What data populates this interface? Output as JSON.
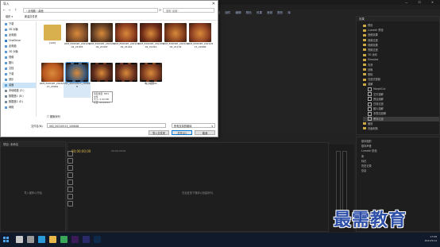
{
  "app": {
    "title": "Adobe Premiere Pro 2020 - C:\\用户\\Admin\\文档\\Adobe\\Premiere Pro\\14.0\\未命名 *",
    "window_controls": "— ☐ ✕",
    "menu": [
      "文件(F)",
      "编辑(E)",
      "剪辑(C)",
      "序列(S)",
      "标记(M)",
      "图形(G)",
      "视图(V)",
      "窗口(W)",
      "帮助(H)"
    ],
    "workspace_tabs": [
      "学习",
      "组件",
      "编辑",
      "颜色",
      "效果",
      "音频",
      "图形",
      "库"
    ]
  },
  "dialog": {
    "title": "导入",
    "close": "✕",
    "nav": {
      "back": "←",
      "forward": "→",
      "up": "↑",
      "refresh": "⟳"
    },
    "address": "› 此电脑 › 桌面",
    "search_placeholder": "搜索\"桌面\"",
    "toolbar": {
      "organize": "组织 ▾",
      "new_folder": "新建文件夹"
    },
    "sidebar": [
      {
        "label": "下载",
        "icon": "download-icon"
      },
      {
        "label": "3D 对象",
        "icon": "cube-icon"
      },
      {
        "label": "此电脑",
        "icon": "computer-icon"
      },
      {
        "label": "OneDrive",
        "icon": "cloud-icon"
      },
      {
        "label": "此电脑",
        "icon": "computer-icon"
      },
      {
        "label": "3D 对象",
        "icon": "cube-icon"
      },
      {
        "label": "视频",
        "icon": "video-icon"
      },
      {
        "label": "图片",
        "icon": "picture-icon"
      },
      {
        "label": "文档",
        "icon": "document-icon"
      },
      {
        "label": "下载",
        "icon": "download-icon"
      },
      {
        "label": "音乐",
        "icon": "music-icon"
      },
      {
        "label": "桌面",
        "icon": "desktop-icon",
        "selected": true
      },
      {
        "label": "本地磁盘 (C:)",
        "icon": "drive-icon"
      },
      {
        "label": "数据盘1 (D:)",
        "icon": "drive-icon"
      },
      {
        "label": "数据盘2 (E:)",
        "icon": "drive-icon"
      },
      {
        "label": "网络",
        "icon": "network-icon"
      }
    ],
    "files": [
      {
        "label": "[120]",
        "kind": "folder",
        "color": "#d8b14e"
      },
      {
        "label": "LRM_EXPORT_20210502_21003",
        "kind": "image",
        "color": "#7a4a2a"
      },
      {
        "label": "LRM_EXPORT_20210502_21003",
        "kind": "image",
        "color": "#5c3a24"
      },
      {
        "label": "LRM_EXPORT_20210502_21012",
        "kind": "image",
        "color": "#8a3a1e"
      },
      {
        "label": "LRM_EXPORT_20210502_21012",
        "kind": "image",
        "color": "#6b2a18"
      },
      {
        "label": "LRM_EXPORT_20210502_21132",
        "kind": "image",
        "color": "#7f3b1c"
      },
      {
        "label": "LRM_EXPORT_20210513_20006",
        "kind": "image",
        "color": "#8c3e22"
      },
      {
        "label": "LRM_EXPORT_20210513_20061",
        "kind": "image",
        "color": "#b8551f"
      },
      {
        "label": "VID_20210513_100648",
        "kind": "video",
        "color": "#3e5a7a",
        "selected": true
      },
      {
        "label": "",
        "kind": "video",
        "color": "#5a2a1c"
      },
      {
        "label": "",
        "kind": "video",
        "color": "#6a3020"
      },
      {
        "label": "电子相册01",
        "kind": "video",
        "color": "#7a3a20"
      }
    ],
    "tooltip": [
      "项目类型: MP4 文件",
      "大小: 4.00 MB",
      "长度: 00:00:01"
    ],
    "sequence_label": "图像序列",
    "filename_label": "文件名(N):",
    "filename_value": "VID_20210513_100648",
    "filetype_value": "所有支持的媒体",
    "buttons": {
      "import_folder": "导入文件夹",
      "open": "打开(O)",
      "cancel": "取消"
    }
  },
  "effects_panel": {
    "title": "效果",
    "items": [
      {
        "label": "预设",
        "type": "folder"
      },
      {
        "label": "Lumetri 预设",
        "type": "folder"
      },
      {
        "label": "音频效果",
        "type": "folder"
      },
      {
        "label": "音频过渡",
        "type": "folder"
      },
      {
        "label": "视频效果",
        "type": "folder"
      },
      {
        "label": "视频过渡",
        "type": "folder"
      },
      {
        "label": "3D 运动",
        "type": "folder"
      },
      {
        "label": "Dissolve",
        "type": "folder"
      },
      {
        "label": "内滑",
        "type": "folder"
      },
      {
        "label": "划像",
        "type": "folder"
      },
      {
        "label": "擦除",
        "type": "folder"
      },
      {
        "label": "沉浸式视频",
        "type": "folder"
      },
      {
        "label": "溶解",
        "type": "folder"
      },
      {
        "label": "MorphCut",
        "type": "fx"
      },
      {
        "label": "交叉溶解",
        "type": "fx"
      },
      {
        "label": "叠加溶解",
        "type": "fx"
      },
      {
        "label": "白场过渡",
        "type": "fx"
      },
      {
        "label": "胶片溶解",
        "type": "fx"
      },
      {
        "label": "非叠加溶解",
        "type": "fx"
      },
      {
        "label": "黑场过渡",
        "type": "fx",
        "selected": true
      },
      {
        "label": "缩放",
        "type": "folder"
      },
      {
        "label": "页面剥落",
        "type": "folder"
      }
    ],
    "lower_tabs": [
      "基本图形",
      "基本声音",
      "Lumetri 颜色",
      "库",
      "标记",
      "历史记录",
      "信息"
    ]
  },
  "project_panel": {
    "title": "项目: 未命名",
    "empty_text": "导入媒体以开始"
  },
  "timeline": {
    "timecode": "00;00;00;00",
    "ruler_start": "00;00;00;00",
    "empty_text": "在此处放下媒体以创建序列。"
  },
  "watermark": "最需教育",
  "taskbar": {
    "time": "17:08",
    "date": "2021/5/14",
    "apps": [
      {
        "icon": "search-icon",
        "color": "#c9c9c9"
      },
      {
        "icon": "task-view-icon",
        "color": "#9a9a9a"
      },
      {
        "icon": "edge-icon",
        "color": "#2b9ad8"
      },
      {
        "icon": "file-explorer-icon",
        "color": "#e8b84a"
      },
      {
        "icon": "browser-icon",
        "color": "#3aa657"
      },
      {
        "icon": "premiere-icon",
        "color": "#3b1a58"
      },
      {
        "icon": "media-encoder-icon",
        "color": "#2a2a6a"
      },
      {
        "icon": "photoshop-icon",
        "color": "#0e2a4a"
      }
    ]
  }
}
